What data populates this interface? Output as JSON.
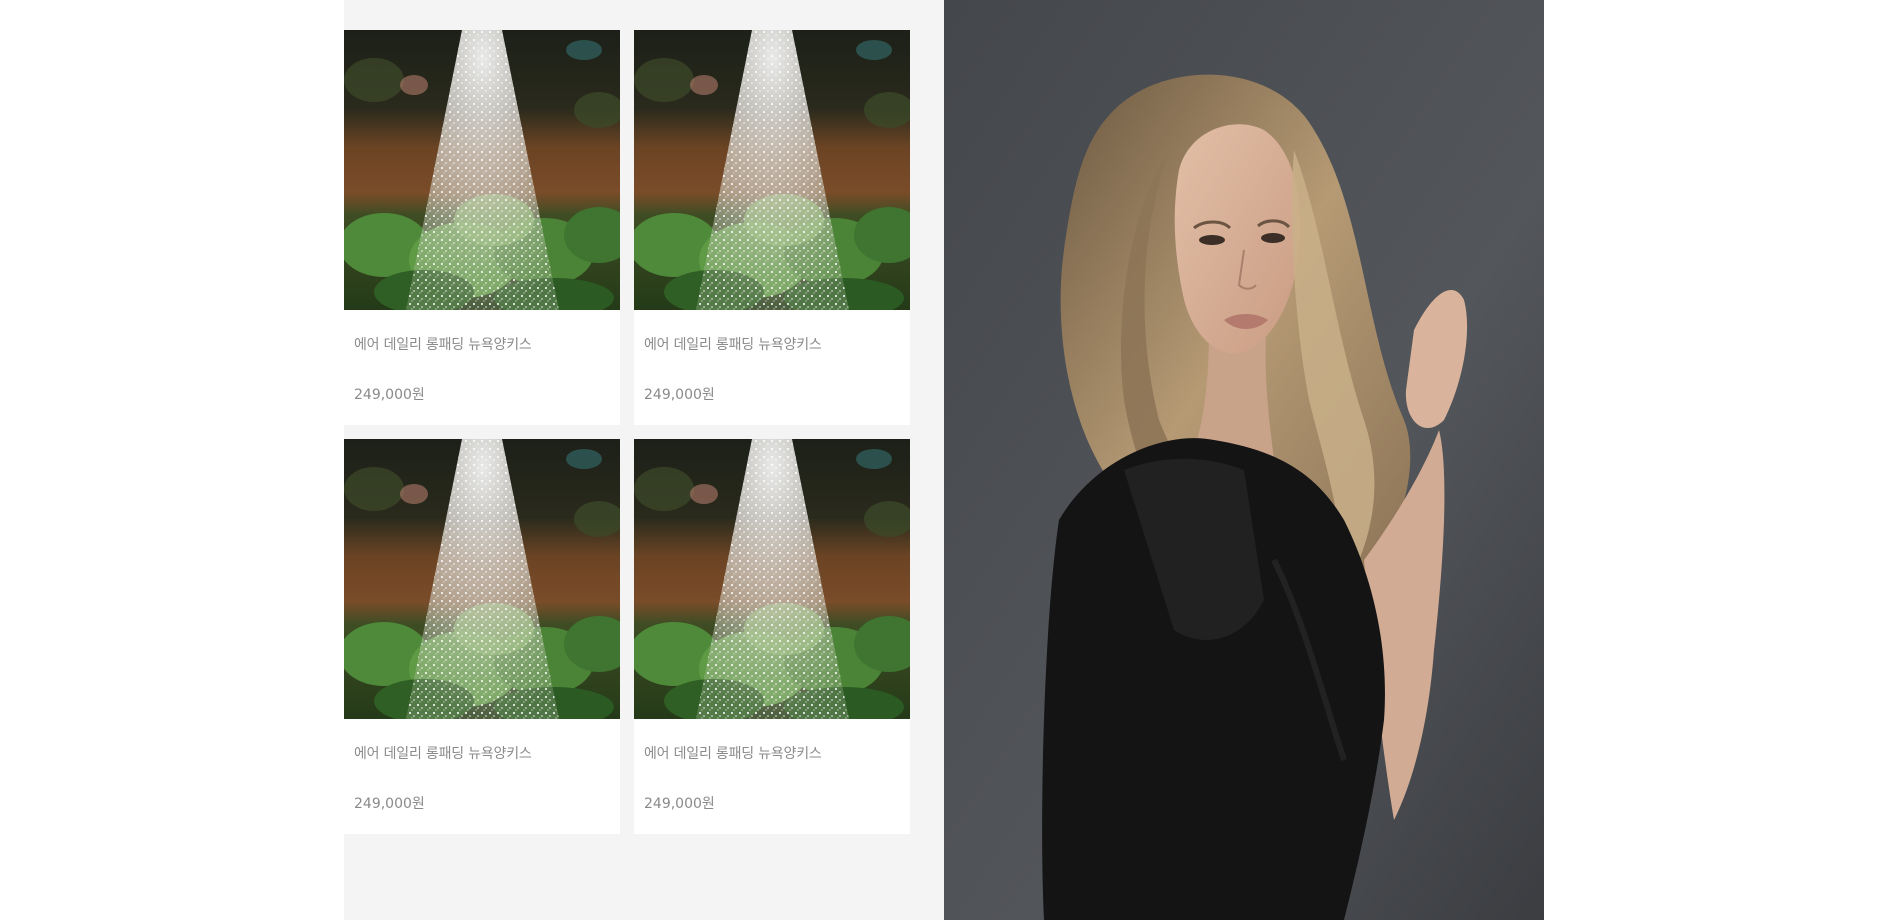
{
  "products": [
    {
      "name": "에어 데일리 롱패딩 뉴욕양키스",
      "price": "249,000원"
    },
    {
      "name": "에어 데일리 롱패딩 뉴욕양키스",
      "price": "249,000원"
    },
    {
      "name": "에어 데일리 롱패딩 뉴욕양키스",
      "price": "249,000원"
    },
    {
      "name": "에어 데일리 롱패딩 뉴욕양키스",
      "price": "249,000원"
    }
  ],
  "colors": {
    "panel_bg": "#f4f4f4",
    "text": "#8a8a8a",
    "hero_bg": "#4a4d52"
  }
}
